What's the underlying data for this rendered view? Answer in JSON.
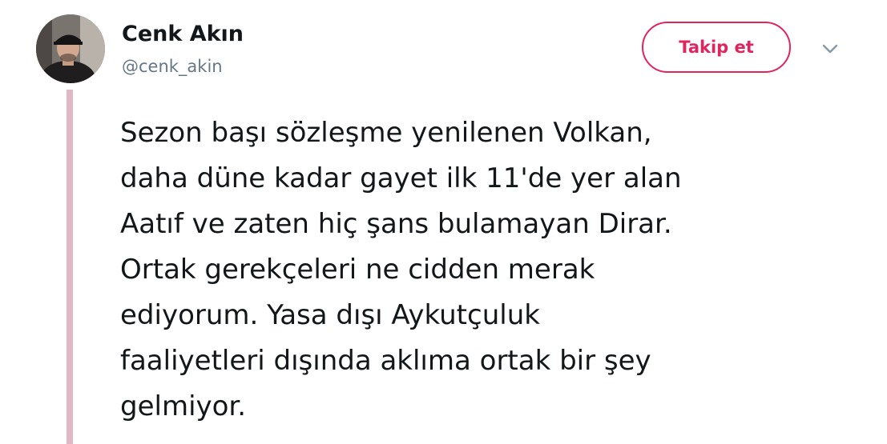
{
  "tweet": {
    "author": {
      "display_name": "Cenk Akın",
      "handle": "@cenk_akin",
      "avatar_icon": "profile-photo"
    },
    "follow_button_label": "Takip et",
    "menu_icon": "chevron-down-icon",
    "text_lines": [
      "Sezon başı sözleşme yenilenen Volkan,",
      "daha düne kadar gayet ilk 11'de yer alan",
      "Aatıf ve zaten hiç şans bulamayan Dirar.",
      "Ortak gerekçeleri ne cidden merak",
      "ediyorum. Yasa dışı Aykutçuluk",
      "faaliyetleri dışında aklıma ortak bir şey",
      "gelmiyor."
    ]
  },
  "colors": {
    "accent": "#e0245e",
    "thread_line": "#e2b8c4",
    "text": "#14171a",
    "secondary_text": "#657786"
  }
}
